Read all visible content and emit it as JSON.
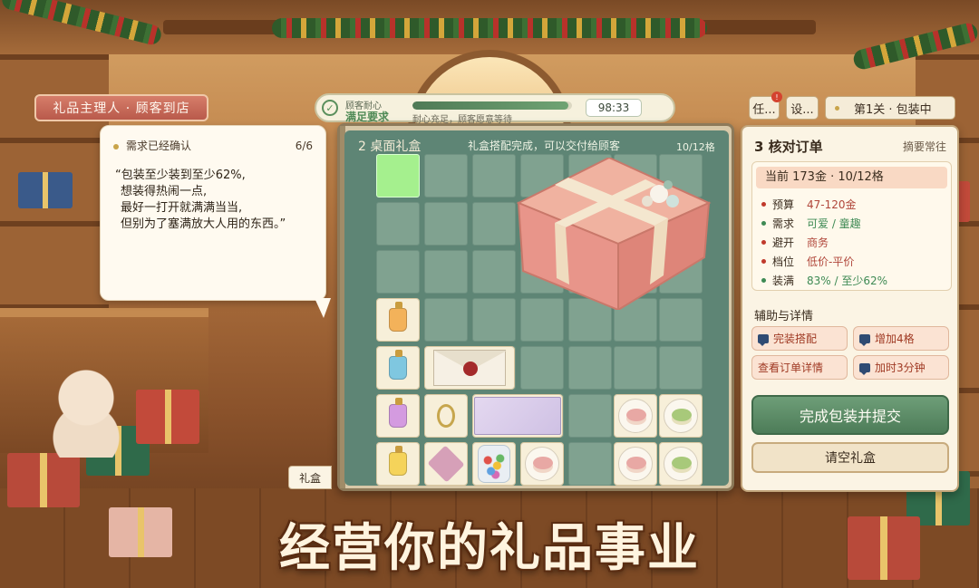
{
  "role_tag": "礼品主理人 · 顾客到店",
  "customer_request": {
    "header": "需求已经确认",
    "progress": "6/6",
    "lines": [
      "“包装至少装到至少62%,",
      "想装得热闹一点,",
      "最好一打开就满满当当,",
      "但别为了塞满放大人用的东西。”"
    ]
  },
  "status_bar": {
    "label_top": "顾客耐心",
    "label_bottom": "满足要求",
    "patience_level": 0.98,
    "patience_text": "耐心充足，顾客愿意等待",
    "timer": "98:33"
  },
  "top_buttons": {
    "task": "任...",
    "task_badge": "!",
    "settings": "设...",
    "level": "第1关 · 包装中"
  },
  "board": {
    "title": "2 桌面礼盒",
    "message": "礼盒搭配完成，可以交付给顾客",
    "count": "10/12格"
  },
  "order_panel": {
    "title": "3 核对订单",
    "link": "摘要常往",
    "current": "当前 173金 · 10/12格",
    "rows": [
      {
        "key": "预算",
        "value": "47-120金",
        "dot": "#c0392b",
        "color": "#b0463a"
      },
      {
        "key": "需求",
        "value": "可爱 / 童趣",
        "dot": "#3e8a54",
        "color": "#3e8a54"
      },
      {
        "key": "避开",
        "value": "商务",
        "dot": "#c0392b",
        "color": "#b0463a"
      },
      {
        "key": "档位",
        "value": "低价-平价",
        "dot": "#c0392b",
        "color": "#b0463a"
      },
      {
        "key": "装满",
        "value": "83% / 至少62%",
        "dot": "#3e8a54",
        "color": "#3e8a54"
      }
    ],
    "section": "辅助与详情",
    "assist_buttons": [
      "完装搭配",
      "增加4格",
      "查看订单详情",
      "加时3分钟"
    ],
    "submit": "完成包装并提交",
    "clear": "请空礼盒"
  },
  "side_tab": "礼盒",
  "slogan": "经营你的礼品事业"
}
